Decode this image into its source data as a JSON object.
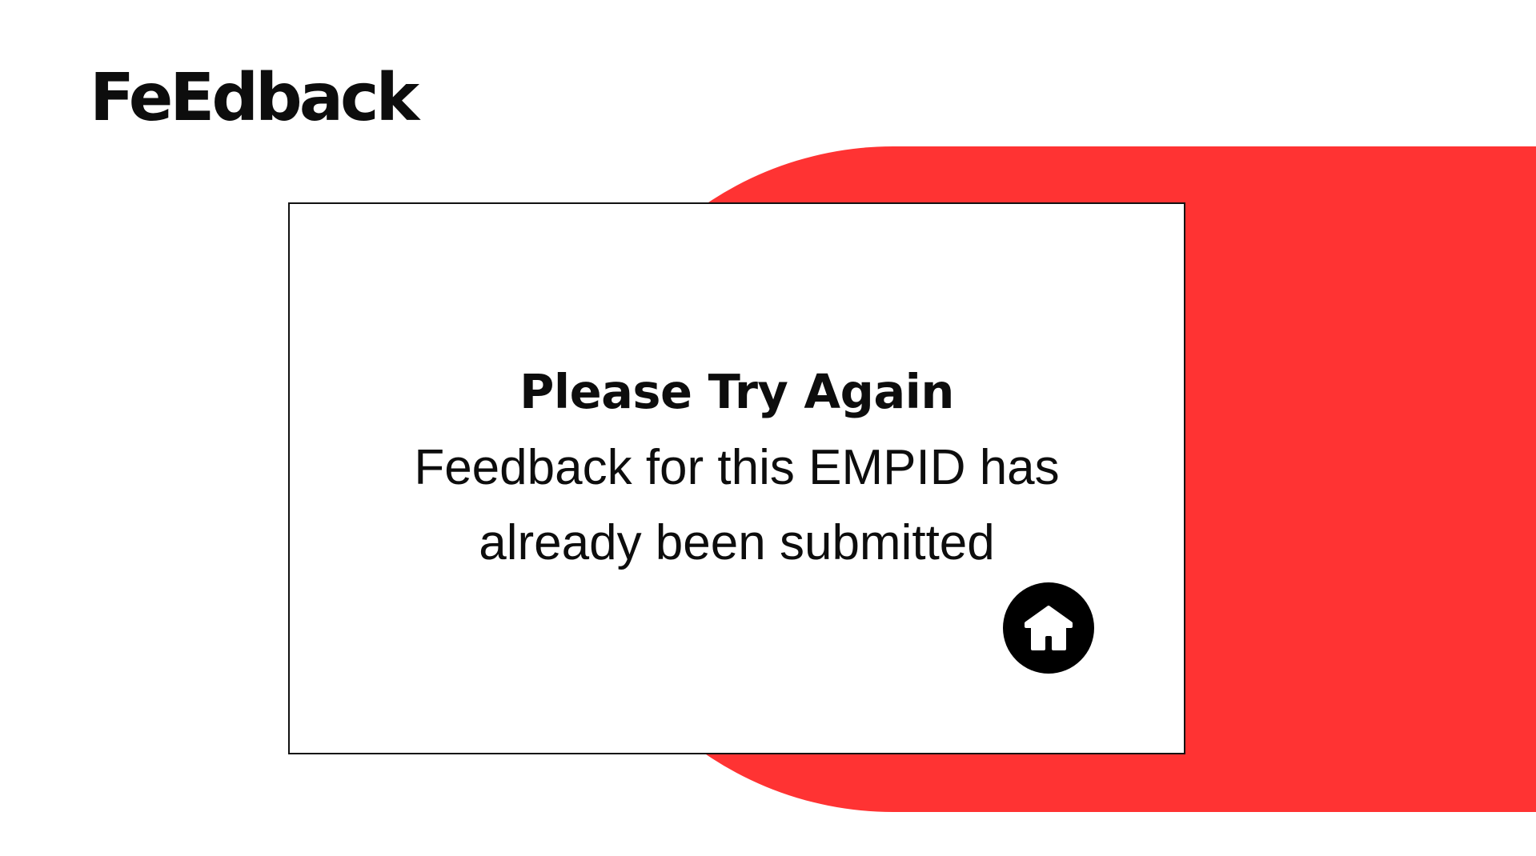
{
  "brand": {
    "logo_text": "FeEdback"
  },
  "colors": {
    "accent": "#ff3333",
    "text": "#0d0d0d",
    "background": "#ffffff"
  },
  "message_card": {
    "title": "Please Try Again",
    "message": "Feedback for this EMPID has already been submitted"
  },
  "home_button": {
    "icon": "home-icon"
  }
}
